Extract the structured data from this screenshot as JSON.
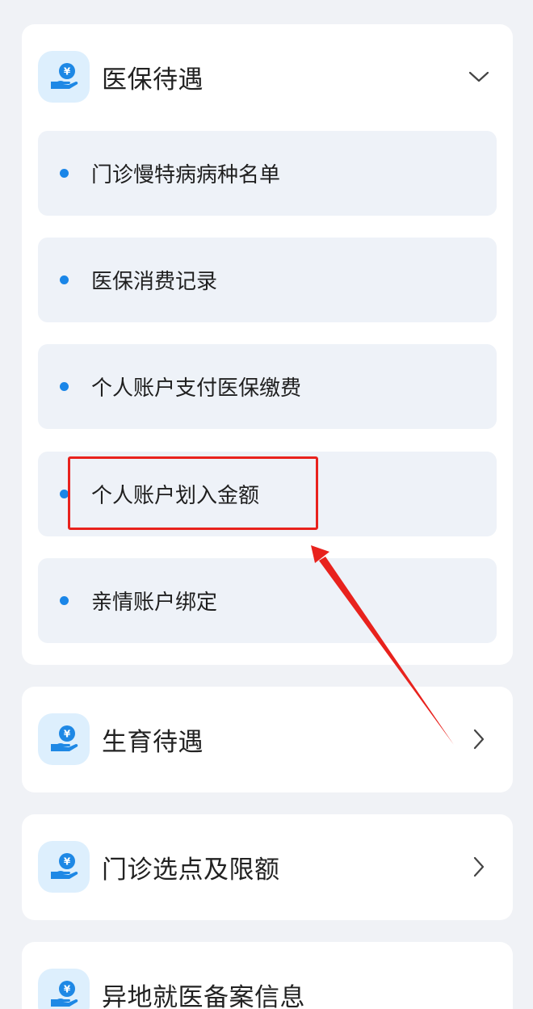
{
  "sections": [
    {
      "title": "医保待遇",
      "icon": "hand-yuan-icon",
      "expanded": true,
      "toggle_icon": "chevron-down-icon",
      "items": [
        {
          "label": "门诊慢特病病种名单"
        },
        {
          "label": "医保消费记录"
        },
        {
          "label": "个人账户支付医保缴费"
        },
        {
          "label": "个人账户划入金额"
        },
        {
          "label": "亲情账户绑定"
        }
      ]
    },
    {
      "title": "生育待遇",
      "icon": "hand-yuan-icon",
      "expanded": false,
      "toggle_icon": "chevron-right-icon"
    },
    {
      "title": "门诊选点及限额",
      "icon": "hand-yuan-icon",
      "expanded": false,
      "toggle_icon": "chevron-right-icon"
    },
    {
      "title": "异地就医备案信息",
      "icon": "hand-yuan-icon",
      "expanded": false,
      "toggle_icon": "chevron-right-icon"
    }
  ],
  "annotation": {
    "highlight_target": "个人账户划入金额",
    "color": "#e8221d"
  },
  "colors": {
    "accent": "#1a86e8",
    "icon_bg": "#ddeffd",
    "sub_item_bg": "#eef2f8",
    "page_bg": "#f0f2f6"
  }
}
